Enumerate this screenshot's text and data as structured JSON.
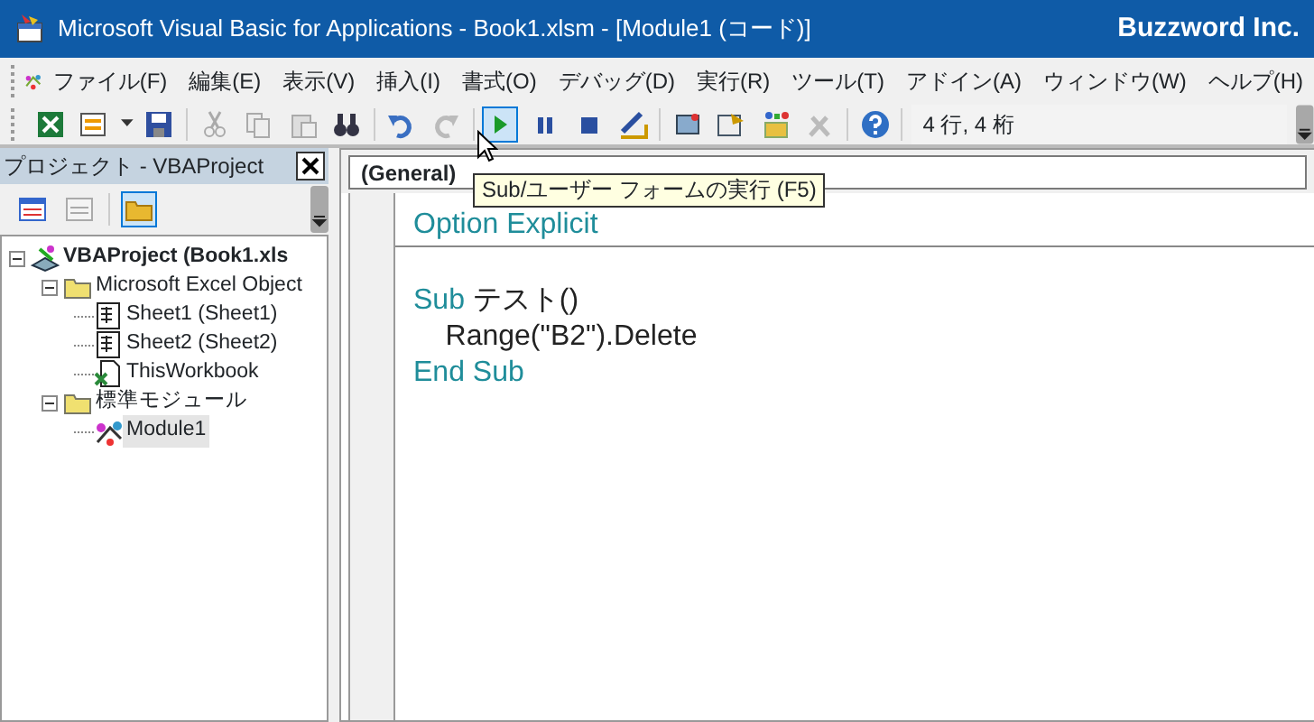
{
  "title_bar": {
    "title": "Microsoft Visual Basic for Applications - Book1.xlsm - [Module1 (コード)]",
    "brand": "Buzzword Inc."
  },
  "menu": [
    {
      "label": "ファイル(F)"
    },
    {
      "label": "編集(E)"
    },
    {
      "label": "表示(V)"
    },
    {
      "label": "挿入(I)"
    },
    {
      "label": "書式(O)"
    },
    {
      "label": "デバッグ(D)"
    },
    {
      "label": "実行(R)"
    },
    {
      "label": "ツール(T)"
    },
    {
      "label": "アドイン(A)"
    },
    {
      "label": "ウィンドウ(W)"
    },
    {
      "label": "ヘルプ(H)"
    }
  ],
  "toolbar": {
    "run_button_highlighted": true,
    "position": "4 行, 4 桁",
    "tooltip": "Sub/ユーザー フォームの実行 (F5)"
  },
  "project_pane": {
    "title": "プロジェクト - VBAProject",
    "tree": [
      {
        "kind": "project",
        "label": "VBAProject (Book1.xls",
        "expanded": true,
        "selected": false,
        "children": [
          {
            "kind": "folder",
            "label": "Microsoft Excel Object",
            "expanded": true,
            "selected": false,
            "children": [
              {
                "kind": "sheet",
                "label": "Sheet1 (Sheet1)",
                "selected": false
              },
              {
                "kind": "sheet",
                "label": "Sheet2 (Sheet2)",
                "selected": false
              },
              {
                "kind": "workbook",
                "label": "ThisWorkbook",
                "selected": false
              }
            ]
          },
          {
            "kind": "folder",
            "label": "標準モジュール",
            "expanded": true,
            "selected": false,
            "children": [
              {
                "kind": "module",
                "label": "Module1",
                "selected": true
              }
            ]
          }
        ]
      }
    ]
  },
  "code_window": {
    "object_box": "(General)",
    "lines": [
      {
        "separator_after": true,
        "gap_before": false,
        "segments": [
          {
            "kind": "keyword",
            "text": "Option Explicit"
          }
        ]
      },
      {
        "separator_after": false,
        "gap_before": true,
        "segments": [
          {
            "kind": "keyword",
            "text": "Sub"
          },
          {
            "kind": "plain",
            "text": " テスト()"
          }
        ]
      },
      {
        "separator_after": false,
        "gap_before": false,
        "segments": [
          {
            "kind": "plain",
            "text": "    Range(\"B2\").Delete"
          }
        ]
      },
      {
        "separator_after": false,
        "gap_before": false,
        "segments": [
          {
            "kind": "keyword",
            "text": "End Sub"
          }
        ]
      }
    ]
  }
}
